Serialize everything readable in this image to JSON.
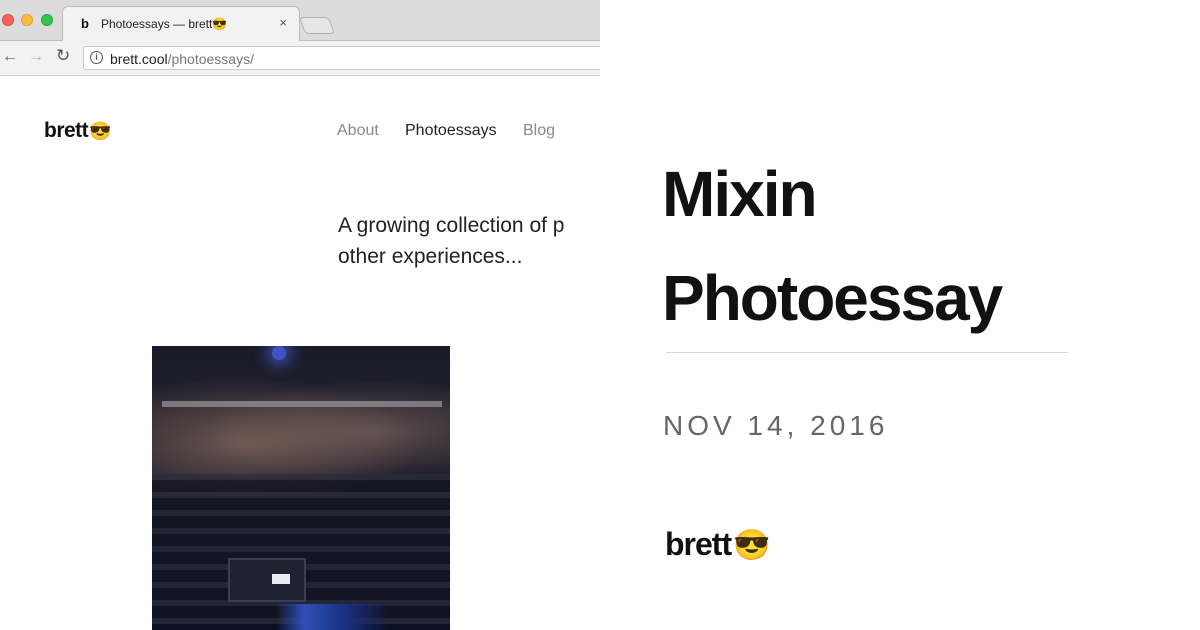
{
  "browser": {
    "tab": {
      "favicon": "b",
      "title": "Photoessays — brett😎",
      "close": "×"
    },
    "toolbar": {
      "back": "←",
      "forward": "→",
      "reload": "↻",
      "info": "i"
    },
    "address": {
      "host": "brett.cool",
      "path": "/photoessays/"
    }
  },
  "site": {
    "logo_text": "brett",
    "logo_emoji": "😎",
    "nav": [
      {
        "label": "About",
        "active": false
      },
      {
        "label": "Photoessays",
        "active": true
      },
      {
        "label": "Blog",
        "active": false
      }
    ],
    "intro": "A growing collection of p\nother experiences..."
  },
  "card": {
    "title_line1": "Mixin",
    "title_line2": "Photoessay",
    "date": "NOV 14, 2016",
    "logo_text": "brett",
    "logo_emoji": "😎"
  }
}
